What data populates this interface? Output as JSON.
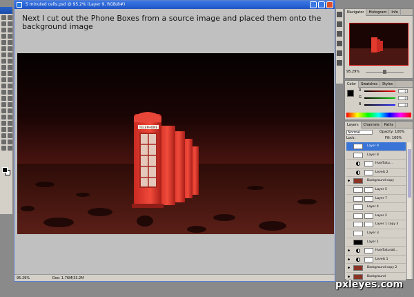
{
  "doc": {
    "title": "5 minuted cells.psd @ 95.2% (Layer 9, RGB/8#)",
    "caption": "Next I cut out the Phone Boxes from a source image and placed them onto the background image",
    "status_zoom": "95.29%",
    "status_doc": "Doc: 1.76M/33.2M"
  },
  "phonebox_sign": "TELEPHONE",
  "navigator": {
    "tabs": [
      "Navigator",
      "Histogram",
      "Info"
    ],
    "zoom": "95.29%"
  },
  "color": {
    "tabs": [
      "Color",
      "Swatches",
      "Styles"
    ],
    "channels": [
      {
        "label": "R",
        "value": "0",
        "color": "#d02020"
      },
      {
        "label": "G",
        "value": "0",
        "color": "#20a020"
      },
      {
        "label": "B",
        "value": "0",
        "color": "#2040d0"
      }
    ]
  },
  "layers": {
    "tabs": [
      "Layers",
      "Channels",
      "Paths"
    ],
    "blend_mode": "Normal",
    "opacity_label": "Opacity: 100%",
    "lock_label": "Lock:",
    "fill_label": "Fill: 100%",
    "items": [
      {
        "name": "Layer 9",
        "selected": true
      },
      {
        "name": "Layer 8"
      },
      {
        "name": "Hue/Satu...",
        "adjustment": true
      },
      {
        "name": "Levels 2",
        "adjustment": true
      },
      {
        "name": "Background copy",
        "visible": true,
        "thumb": "red"
      },
      {
        "name": "Layer 5",
        "masked": true
      },
      {
        "name": "Layer 7",
        "masked": true
      },
      {
        "name": "Layer 4"
      },
      {
        "name": "Layer 2",
        "masked": true
      },
      {
        "name": "Layer 1 copy 3",
        "masked": true
      },
      {
        "name": "Layer 3"
      },
      {
        "name": "Layer 1",
        "thumb": "black"
      },
      {
        "name": "Hue/Saturati...",
        "adjustment": true,
        "visible": true
      },
      {
        "name": "Levels 1",
        "adjustment": true,
        "visible": true
      },
      {
        "name": "Background copy 2",
        "visible": true,
        "thumb": "red"
      },
      {
        "name": "Background",
        "visible": true,
        "thumb": "red"
      }
    ]
  },
  "watermark": "pxleyes.com"
}
